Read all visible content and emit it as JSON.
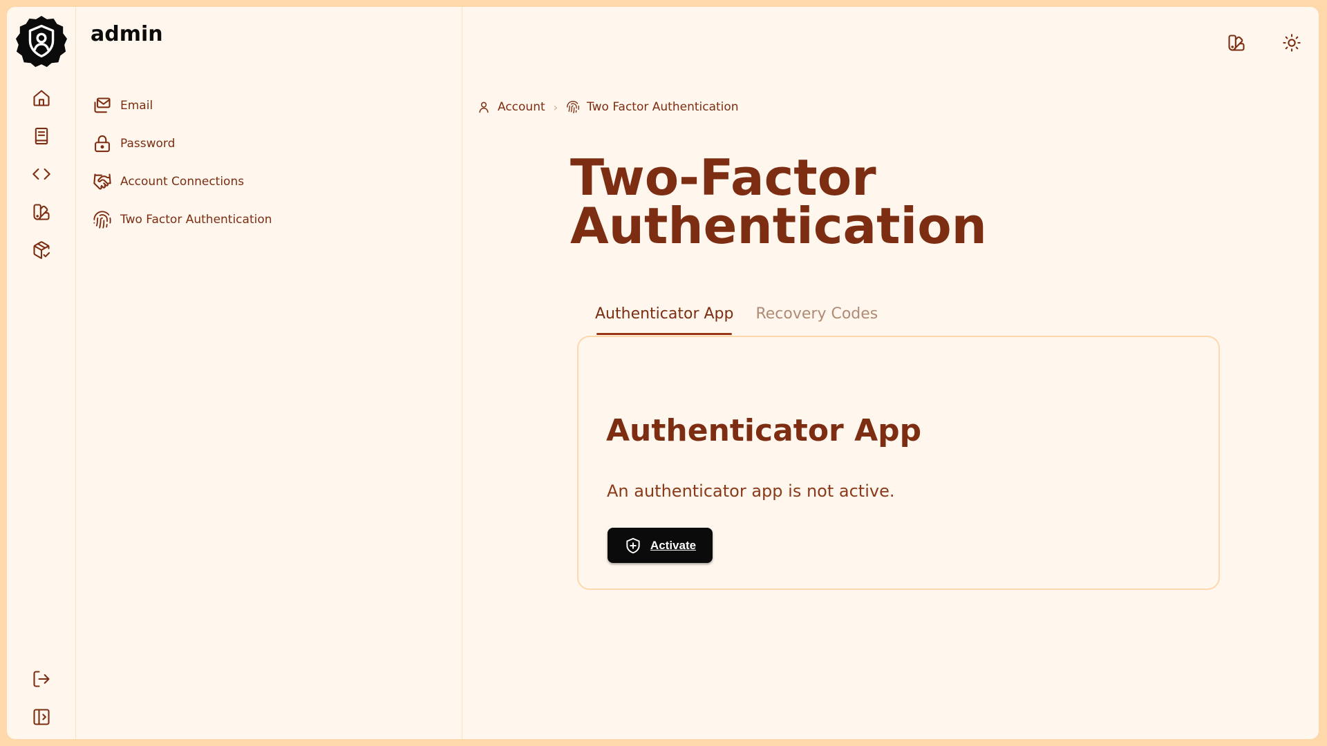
{
  "colors": {
    "accent": "#7c2d12",
    "background": "#fff7ed",
    "border": "#fed7aa",
    "button_bg": "#0b0b0b"
  },
  "rail": {
    "logo_icon": "shield-user-icon",
    "items": [
      {
        "icon": "home-icon"
      },
      {
        "icon": "book-icon"
      },
      {
        "icon": "code-icon"
      },
      {
        "icon": "swatch-book-icon"
      },
      {
        "icon": "package-check-icon"
      }
    ],
    "bottom": [
      {
        "icon": "logout-icon"
      },
      {
        "icon": "sidebar-toggle-icon"
      }
    ]
  },
  "sidebar": {
    "title": "admin",
    "items": [
      {
        "label": "Email",
        "icon": "mail-icon"
      },
      {
        "label": "Password",
        "icon": "lock-icon"
      },
      {
        "label": "Account Connections",
        "icon": "handshake-icon"
      },
      {
        "label": "Two Factor Authentication",
        "icon": "fingerprint-icon"
      }
    ]
  },
  "header": {
    "icons": [
      "swatch-book-icon",
      "sun-icon"
    ]
  },
  "breadcrumb": {
    "items": [
      {
        "label": "Account",
        "icon": "user-icon"
      },
      {
        "label": "Two Factor Authentication",
        "icon": "fingerprint-icon"
      }
    ],
    "separator": "›"
  },
  "page": {
    "title_line1": "Two-Factor",
    "title_line2": "Authentication"
  },
  "tabs": [
    {
      "label": "Authenticator App",
      "active": true
    },
    {
      "label": "Recovery Codes",
      "active": false
    }
  ],
  "card": {
    "title": "Authenticator App",
    "text": "An authenticator app is not active.",
    "button_label": "Activate",
    "button_icon": "shield-plus-icon"
  }
}
